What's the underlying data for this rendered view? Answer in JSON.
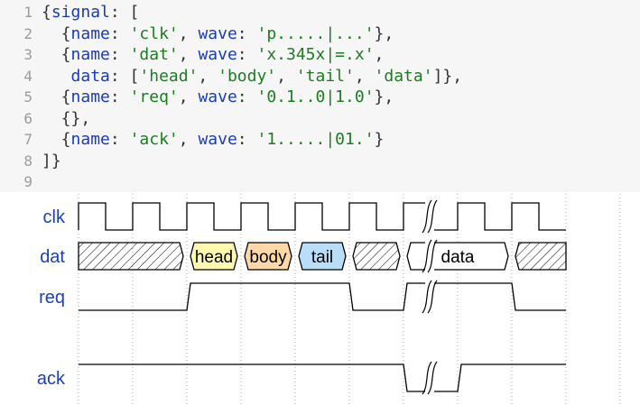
{
  "editor": {
    "lines": [
      {
        "num": "1",
        "tokens": [
          {
            "t": "p",
            "v": "{"
          },
          {
            "t": "k",
            "v": "signal"
          },
          {
            "t": "p",
            "v": ": ["
          }
        ]
      },
      {
        "num": "2",
        "tokens": [
          {
            "t": "p",
            "v": "  {"
          },
          {
            "t": "k",
            "v": "name"
          },
          {
            "t": "p",
            "v": ": "
          },
          {
            "t": "s",
            "v": "'clk'"
          },
          {
            "t": "p",
            "v": ", "
          },
          {
            "t": "k",
            "v": "wave"
          },
          {
            "t": "p",
            "v": ": "
          },
          {
            "t": "s",
            "v": "'p.....|...'"
          },
          {
            "t": "p",
            "v": "},"
          }
        ]
      },
      {
        "num": "3",
        "tokens": [
          {
            "t": "p",
            "v": "  {"
          },
          {
            "t": "k",
            "v": "name"
          },
          {
            "t": "p",
            "v": ": "
          },
          {
            "t": "s",
            "v": "'dat'"
          },
          {
            "t": "p",
            "v": ", "
          },
          {
            "t": "k",
            "v": "wave"
          },
          {
            "t": "p",
            "v": ": "
          },
          {
            "t": "s",
            "v": "'x.345x|=.x'"
          },
          {
            "t": "p",
            "v": ","
          }
        ]
      },
      {
        "num": "4",
        "tokens": [
          {
            "t": "p",
            "v": "   "
          },
          {
            "t": "k",
            "v": "data"
          },
          {
            "t": "p",
            "v": ": ["
          },
          {
            "t": "s",
            "v": "'head'"
          },
          {
            "t": "p",
            "v": ", "
          },
          {
            "t": "s",
            "v": "'body'"
          },
          {
            "t": "p",
            "v": ", "
          },
          {
            "t": "s",
            "v": "'tail'"
          },
          {
            "t": "p",
            "v": ", "
          },
          {
            "t": "s",
            "v": "'data'"
          },
          {
            "t": "p",
            "v": "]},"
          }
        ]
      },
      {
        "num": "5",
        "tokens": [
          {
            "t": "p",
            "v": "  {"
          },
          {
            "t": "k",
            "v": "name"
          },
          {
            "t": "p",
            "v": ": "
          },
          {
            "t": "s",
            "v": "'req'"
          },
          {
            "t": "p",
            "v": ", "
          },
          {
            "t": "k",
            "v": "wave"
          },
          {
            "t": "p",
            "v": ": "
          },
          {
            "t": "s",
            "v": "'0.1..0|1.0'"
          },
          {
            "t": "p",
            "v": "},"
          }
        ]
      },
      {
        "num": "6",
        "tokens": [
          {
            "t": "p",
            "v": "  {},"
          }
        ]
      },
      {
        "num": "7",
        "tokens": [
          {
            "t": "p",
            "v": "  {"
          },
          {
            "t": "k",
            "v": "name"
          },
          {
            "t": "p",
            "v": ": "
          },
          {
            "t": "s",
            "v": "'ack'"
          },
          {
            "t": "p",
            "v": ", "
          },
          {
            "t": "k",
            "v": "wave"
          },
          {
            "t": "p",
            "v": ": "
          },
          {
            "t": "s",
            "v": "'1.....|01.'"
          },
          {
            "t": "p",
            "v": "}"
          }
        ]
      },
      {
        "num": "8",
        "tokens": [
          {
            "t": "p",
            "v": "]}"
          }
        ]
      },
      {
        "num": "9",
        "tokens": []
      }
    ]
  },
  "waveform": {
    "signals": [
      {
        "name": "clk",
        "wave": "p.....|..."
      },
      {
        "name": "dat",
        "wave": "x.345x|=.x",
        "data": [
          "head",
          "body",
          "tail",
          "data"
        ]
      },
      {
        "name": "req",
        "wave": "0.1..0|1.0"
      },
      {
        "name": "",
        "wave": ""
      },
      {
        "name": "ack",
        "wave": "1.....|01."
      }
    ],
    "colors": {
      "label": "#1b40b8",
      "line": "#000000",
      "grid": "#aaaaaa",
      "head": "#fff9b0",
      "body": "#ffd8a8",
      "tail": "#b9def7",
      "data": "#ffffff"
    }
  }
}
